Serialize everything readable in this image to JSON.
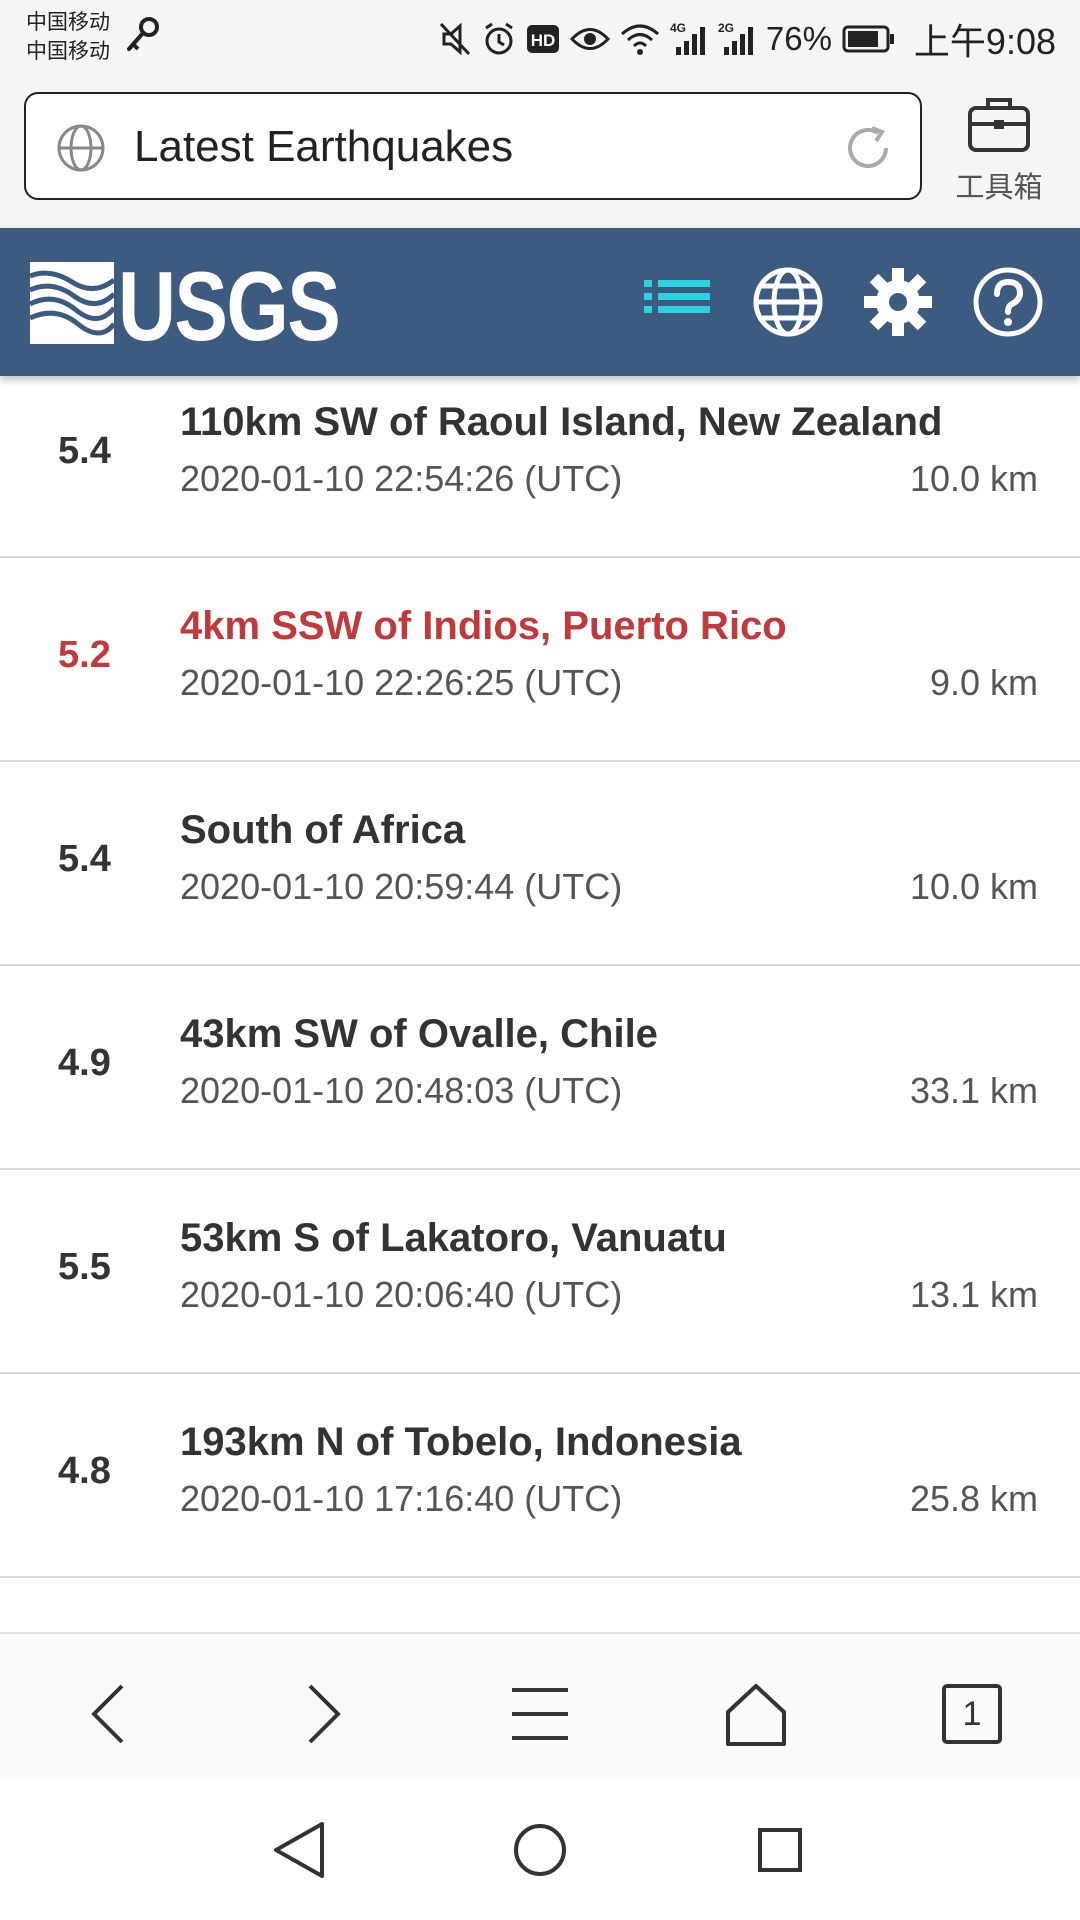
{
  "status_bar": {
    "carrier_1": "中国移动",
    "carrier_2": "中国移动",
    "net_1": "4G",
    "net_2": "2G",
    "hd_badge": "HD",
    "battery_percent": "76%",
    "time": "上午9:08"
  },
  "browser": {
    "url_title": "Latest Earthquakes",
    "toolbox_label": "工具箱",
    "tab_count": "1"
  },
  "header": {
    "logo_text": "USGS",
    "colors": {
      "header_bg": "#3d5a80",
      "active_icon": "#29d4e0"
    },
    "icons": [
      "list-icon",
      "globe-icon",
      "gear-icon",
      "help-icon"
    ]
  },
  "earthquakes": [
    {
      "magnitude": "5.4",
      "place": "110km SW of Raoul Island, New Zealand",
      "time": "2020-01-10 22:54:26 (UTC)",
      "depth": "10.0 km"
    },
    {
      "magnitude": "5.2",
      "place": "4km SSW of Indios, Puerto Rico",
      "time": "2020-01-10 22:26:25 (UTC)",
      "depth": "9.0 km",
      "highlight_color": "#c0393b"
    },
    {
      "magnitude": "5.4",
      "place": "South of Africa",
      "time": "2020-01-10 20:59:44 (UTC)",
      "depth": "10.0 km"
    },
    {
      "magnitude": "4.9",
      "place": "43km SW of Ovalle, Chile",
      "time": "2020-01-10 20:48:03 (UTC)",
      "depth": "33.1 km"
    },
    {
      "magnitude": "5.5",
      "place": "53km S of Lakatoro, Vanuatu",
      "time": "2020-01-10 20:06:40 (UTC)",
      "depth": "13.1 km"
    },
    {
      "magnitude": "4.8",
      "place": "193km N of Tobelo, Indonesia",
      "time": "2020-01-10 17:16:40 (UTC)",
      "depth": "25.8 km"
    }
  ]
}
